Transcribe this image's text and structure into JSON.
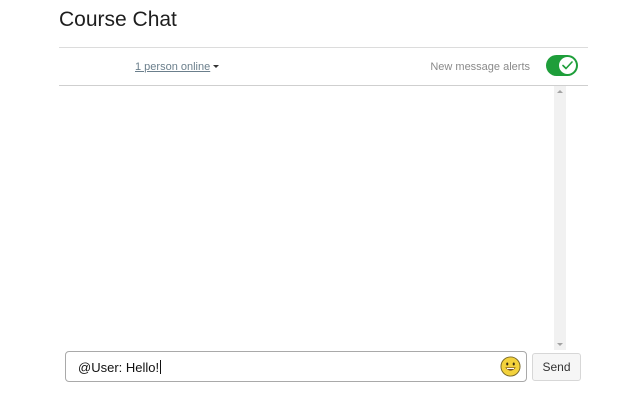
{
  "header": {
    "title": "Course Chat"
  },
  "toolbar": {
    "online_label": "1 person online",
    "alerts_label": "New message alerts",
    "alerts_enabled": true,
    "toggle_color": "#1e9e3a"
  },
  "messages": [],
  "composer": {
    "value": "@User: Hello!",
    "emoji_icon": "smiley-face-icon",
    "send_label": "Send"
  }
}
